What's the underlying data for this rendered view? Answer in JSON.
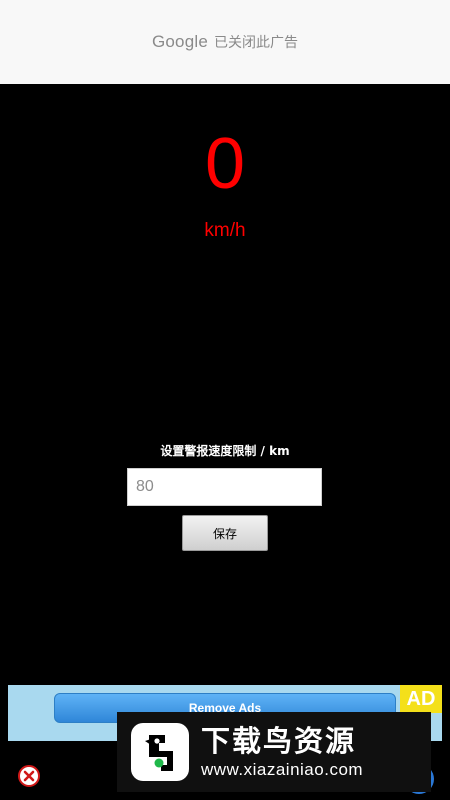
{
  "ad_closed_notice": {
    "brand": "Google",
    "text": "已关闭此广告"
  },
  "speedometer": {
    "speed_value": "0",
    "unit": "km/h",
    "color": "#ff0000"
  },
  "alert_settings": {
    "label": "设置警报速度限制 / km",
    "limit_value": "80",
    "save_label": "保存"
  },
  "ad_banner": {
    "remove_ads_label": "Remove Ads",
    "badge": "AD",
    "background": "#a9d9ef"
  },
  "watermark": {
    "title": "下载鸟资源",
    "url": "www.xiazainiao.com"
  },
  "icons": {
    "close": "close-ad-icon",
    "logo": "bird-logo-icon"
  }
}
